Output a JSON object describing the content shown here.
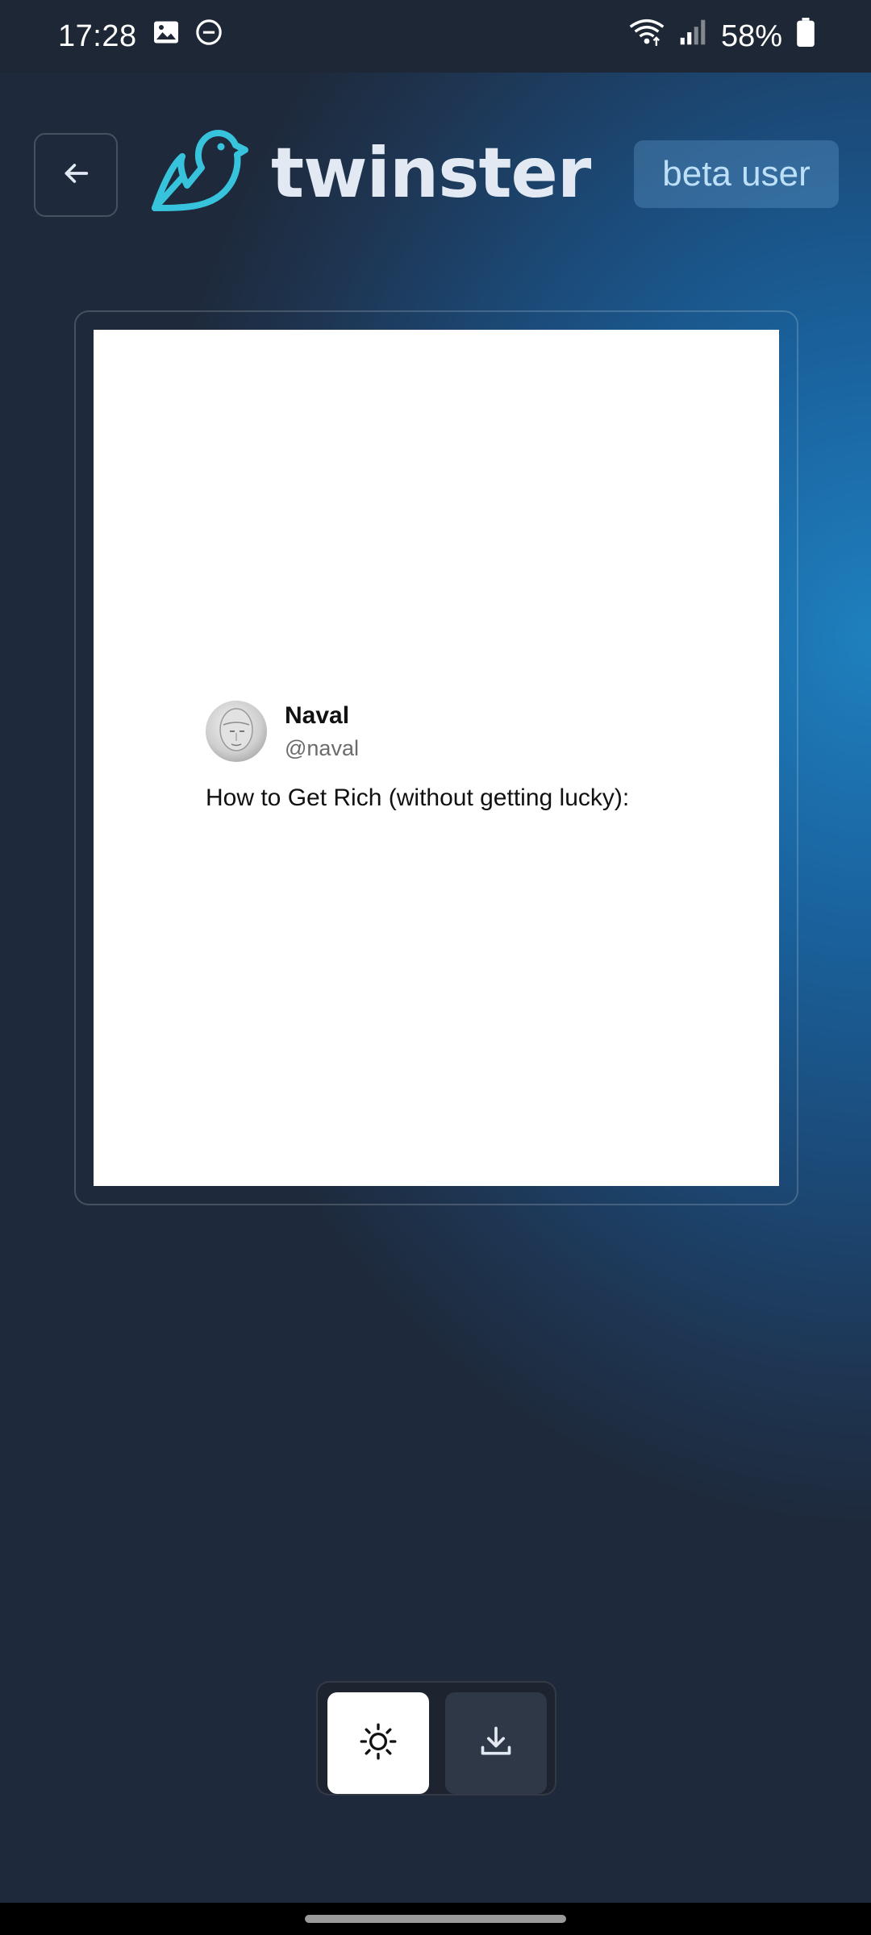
{
  "status_bar": {
    "time": "17:28",
    "battery": "58%",
    "icons": [
      "gallery-icon",
      "dnd-icon",
      "wifi-icon",
      "signal-icon",
      "battery-icon"
    ]
  },
  "header": {
    "back_icon": "arrow-left-icon",
    "app_name": "twinster",
    "logo_icon": "bird-icon",
    "badge": "beta user"
  },
  "tweet": {
    "name": "Naval",
    "handle": "@naval",
    "text": "How to Get Rich (without getting lucky):"
  },
  "controls": {
    "theme_icon": "sun-icon",
    "download_icon": "download-icon"
  },
  "colors": {
    "accent": "#38c3dc",
    "badge_text": "#bde0f8",
    "background_dark": "#1e2735"
  }
}
